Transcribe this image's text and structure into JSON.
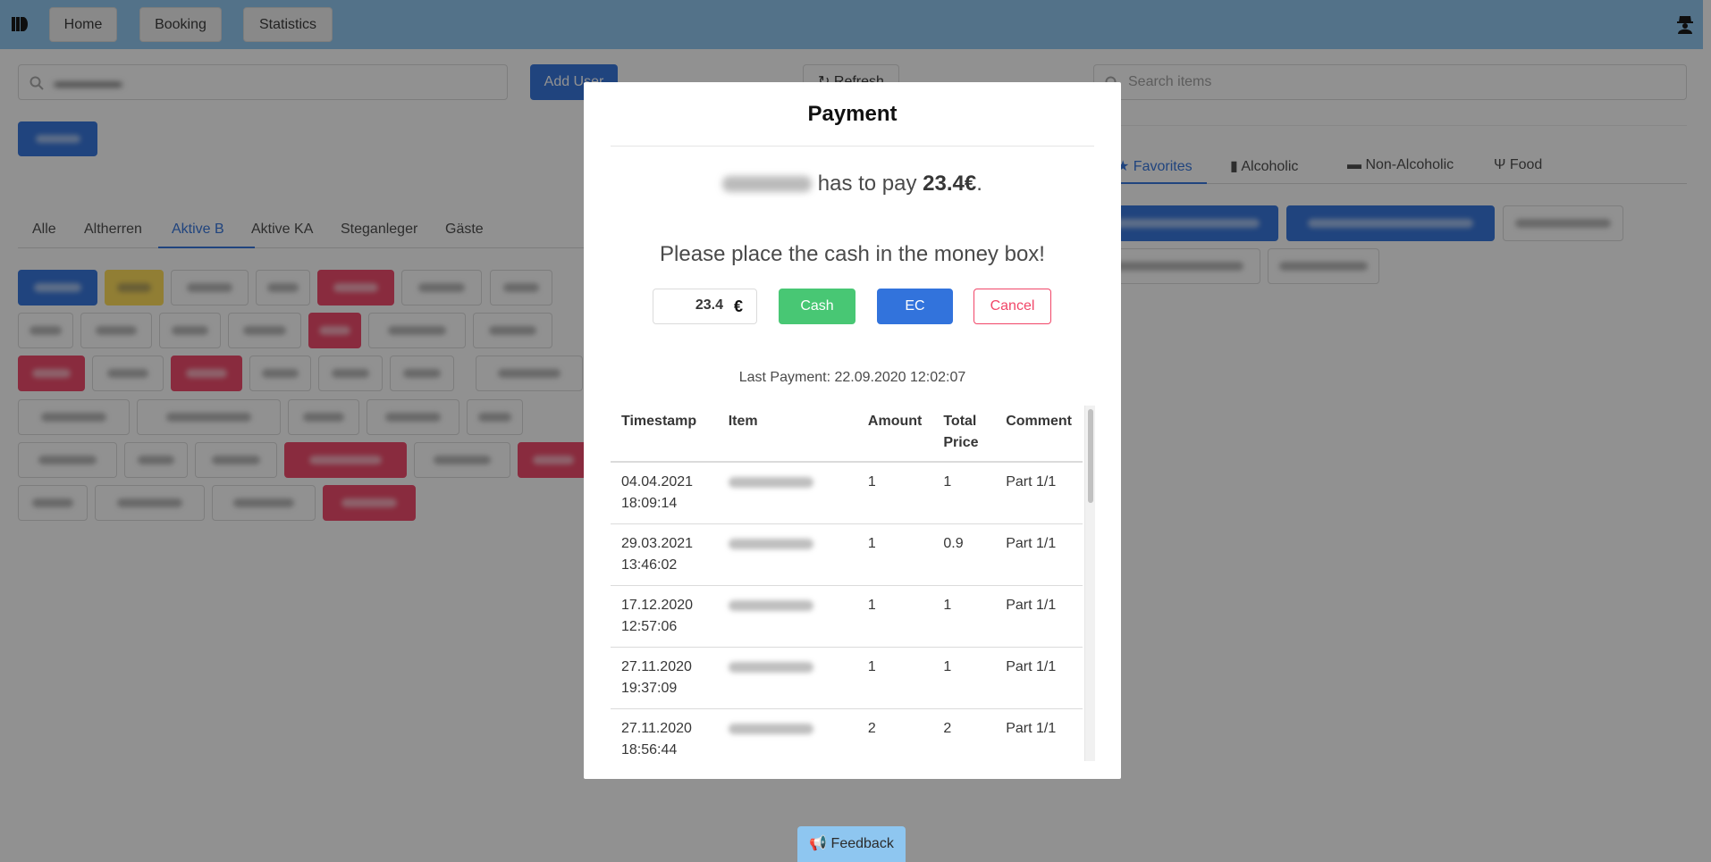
{
  "nav": {
    "buttons": [
      "Home",
      "Booking",
      "Statistics"
    ]
  },
  "left": {
    "add_user": "Add User",
    "group_tabs": [
      "Alle",
      "Altherren",
      "Aktive B",
      "Aktive KA",
      "Steganleger",
      "Gäste"
    ],
    "active_group": "Aktive B"
  },
  "middle": {
    "refresh": "Refresh"
  },
  "right": {
    "search_placeholder": "Search items",
    "category_tabs": [
      "Favorites",
      "Alcoholic",
      "Non-Alcoholic",
      "Food"
    ],
    "active_category": "Favorites"
  },
  "feedback": "Feedback",
  "modal": {
    "title": "Payment",
    "pay_text": "has to pay",
    "pay_amount": "23.4€",
    "pay_end": ".",
    "instruction": "Please place the cash in the money box!",
    "amount_value": "23.4",
    "currency": "€",
    "cash": "Cash",
    "ec": "EC",
    "cancel": "Cancel",
    "last_payment": "Last Payment: 22.09.2020 12:02:07",
    "table": {
      "headers": [
        "Timestamp",
        "Item",
        "Amount",
        "Total Price",
        "Comment"
      ],
      "rows": [
        {
          "date": "04.04.2021",
          "time": "18:09:14",
          "amount": "1",
          "total": "1",
          "comment": "Part 1/1"
        },
        {
          "date": "29.03.2021",
          "time": "13:46:02",
          "amount": "1",
          "total": "0.9",
          "comment": "Part 1/1"
        },
        {
          "date": "17.12.2020",
          "time": "12:57:06",
          "amount": "1",
          "total": "1",
          "comment": "Part 1/1"
        },
        {
          "date": "27.11.2020",
          "time": "19:37:09",
          "amount": "1",
          "total": "1",
          "comment": "Part 1/1"
        },
        {
          "date": "27.11.2020",
          "time": "18:56:44",
          "amount": "2",
          "total": "2",
          "comment": "Part 1/1"
        }
      ]
    }
  },
  "colors": {
    "navbar": "#8ec6f0",
    "primary": "#3273dc",
    "success": "#48c774",
    "danger": "#f14668",
    "warning": "#ffdd57"
  }
}
